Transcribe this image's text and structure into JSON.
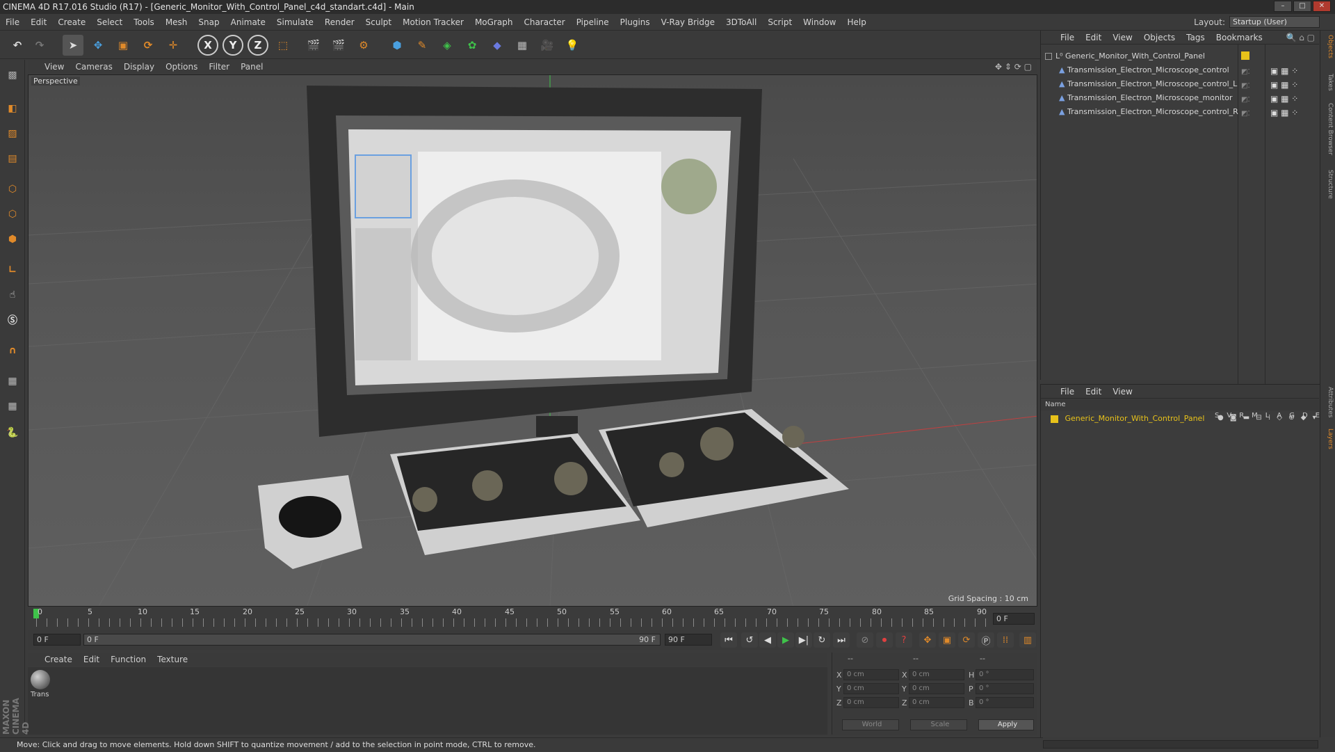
{
  "window": {
    "title": "CINEMA 4D R17.016 Studio (R17) - [Generic_Monitor_With_Control_Panel_c4d_standart.c4d] - Main"
  },
  "menubar": {
    "items": [
      "File",
      "Edit",
      "Create",
      "Select",
      "Tools",
      "Mesh",
      "Snap",
      "Animate",
      "Simulate",
      "Render",
      "Sculpt",
      "Motion Tracker",
      "MoGraph",
      "Character",
      "Pipeline",
      "Plugins",
      "V-Ray Bridge",
      "3DToAll",
      "Script",
      "Window",
      "Help"
    ],
    "layout_label": "Layout:",
    "layout_value": "Startup (User)"
  },
  "toolbar": {
    "axis_x": "X",
    "axis_y": "Y",
    "axis_z": "Z"
  },
  "viewport": {
    "menu": [
      "View",
      "Cameras",
      "Display",
      "Options",
      "Filter",
      "Panel"
    ],
    "label": "Perspective",
    "grid_spacing": "Grid Spacing : 10 cm"
  },
  "timeline": {
    "ticks": [
      "0",
      "5",
      "10",
      "15",
      "20",
      "25",
      "30",
      "35",
      "40",
      "45",
      "50",
      "55",
      "60",
      "65",
      "70",
      "75",
      "80",
      "85",
      "90"
    ],
    "current_frame": "0 F",
    "start_frame": "0 F",
    "range_start": "0 F",
    "range_end": "90 F",
    "end_frame": "90 F"
  },
  "material_manager": {
    "menu": [
      "Create",
      "Edit",
      "Function",
      "Texture"
    ],
    "material_label": "Trans"
  },
  "coordinates": {
    "header": [
      "--",
      "--",
      "--"
    ],
    "rows": [
      {
        "axis": "X",
        "pos": "0 cm",
        "axis2": "X",
        "size": "0 cm",
        "rot_label": "H",
        "rot": "0 °"
      },
      {
        "axis": "Y",
        "pos": "0 cm",
        "axis2": "Y",
        "size": "0 cm",
        "rot_label": "P",
        "rot": "0 °"
      },
      {
        "axis": "Z",
        "pos": "0 cm",
        "axis2": "Z",
        "size": "0 cm",
        "rot_label": "B",
        "rot": "0 °"
      }
    ],
    "mode1": "World",
    "mode2": "Scale",
    "apply": "Apply"
  },
  "status": {
    "text": "Move: Click and drag to move elements. Hold down SHIFT to quantize movement / add to the selection in point mode, CTRL to remove."
  },
  "object_manager": {
    "menu": [
      "File",
      "Edit",
      "View",
      "Objects",
      "Tags",
      "Bookmarks"
    ],
    "objects": [
      "Generic_Monitor_With_Control_Panel",
      "Transmission_Electron_Microscope_control",
      "Transmission_Electron_Microscope_control_L",
      "Transmission_Electron_Microscope_monitor",
      "Transmission_Electron_Microscope_control_R"
    ]
  },
  "layer_manager": {
    "menu": [
      "File",
      "Edit",
      "View"
    ],
    "columns": "Name",
    "column_flags": [
      "S",
      "V",
      "R",
      "M",
      "L",
      "A",
      "G",
      "D",
      "E"
    ],
    "layer_name": "Generic_Monitor_With_Control_Panel",
    "layer_color": "#e8c21a"
  },
  "side_tabs": [
    "Objects",
    "Takes",
    "Content Browser",
    "Structure",
    "Attributes",
    "Layers"
  ],
  "brand": {
    "maxon": "MAXON",
    "c4d": "CINEMA 4D"
  },
  "colors": {
    "accent_orange": "#e08a2a",
    "axis_blue": "#4aa0e0",
    "highlight_yellow": "#e8c21a"
  }
}
